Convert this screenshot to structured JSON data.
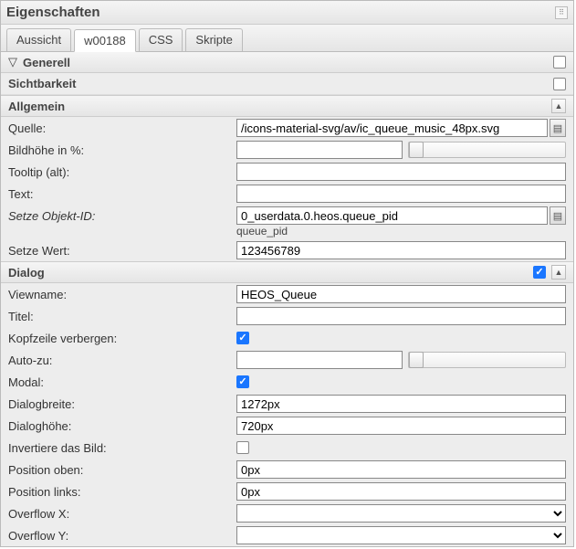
{
  "panel": {
    "title": "Eigenschaften"
  },
  "tabs": [
    {
      "label": "Aussicht"
    },
    {
      "label": "w00188"
    },
    {
      "label": "CSS"
    },
    {
      "label": "Skripte"
    }
  ],
  "groups": {
    "generell": {
      "title": "Generell",
      "checked": false
    },
    "sichtbarkeit": {
      "title": "Sichtbarkeit",
      "checked": false
    },
    "allgemein": {
      "title": "Allgemein"
    },
    "dialog": {
      "title": "Dialog",
      "checked": true
    }
  },
  "allgemein": {
    "quelle": {
      "label": "Quelle:",
      "value": "/icons-material-svg/av/ic_queue_music_48px.svg"
    },
    "bildhoehe": {
      "label": "Bildhöhe in %:",
      "value": ""
    },
    "tooltip": {
      "label": "Tooltip (alt):",
      "value": ""
    },
    "text": {
      "label": "Text:",
      "value": ""
    },
    "objektid": {
      "label": "Setze Objekt-ID:",
      "value": "0_userdata.0.heos.queue_pid",
      "hint": "queue_pid"
    },
    "wert": {
      "label": "Setze Wert:",
      "value": "123456789"
    }
  },
  "dialog": {
    "viewname": {
      "label": "Viewname:",
      "value": "HEOS_Queue"
    },
    "titel": {
      "label": "Titel:",
      "value": ""
    },
    "kopfzeile": {
      "label": "Kopfzeile verbergen:",
      "checked": true
    },
    "autozu": {
      "label": "Auto-zu:",
      "value": ""
    },
    "modal": {
      "label": "Modal:",
      "checked": true
    },
    "breite": {
      "label": "Dialogbreite:",
      "value": "1272px"
    },
    "hoehe": {
      "label": "Dialoghöhe:",
      "value": "720px"
    },
    "invertiere": {
      "label": "Invertiere das Bild:",
      "checked": false
    },
    "posoben": {
      "label": "Position oben:",
      "value": "0px"
    },
    "poslinks": {
      "label": "Position links:",
      "value": "0px"
    },
    "overflowx": {
      "label": "Overflow X:",
      "value": ""
    },
    "overflowy": {
      "label": "Overflow Y:",
      "value": ""
    }
  }
}
